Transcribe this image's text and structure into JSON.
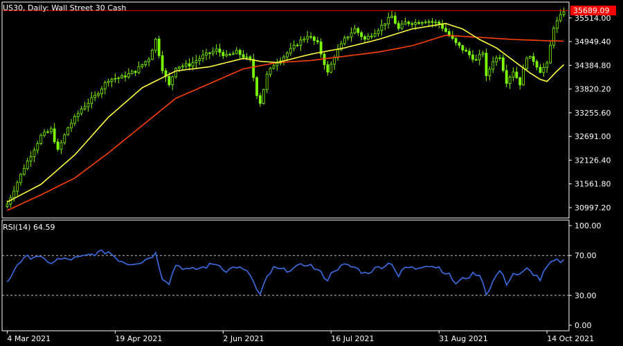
{
  "window": {
    "title_line": "US30, Daily:  Wall Street 30 Cash",
    "rsi_title": "RSI(14) 64.59"
  },
  "colors": {
    "background": "#000000",
    "frame": "#ffffff",
    "bull_candle": "#7cfc00",
    "bear_candle": "#7cfc00",
    "ma_fast": "#ffff40",
    "ma_slow": "#ff4000",
    "rsi_line": "#3c6ee6",
    "price_line": "#ff0000",
    "level_line": "#c0c0c0"
  },
  "chart_data": [
    {
      "type": "candlestick",
      "title": "US30, Daily:  Wall Street 30 Cash",
      "price_label": "35689.09",
      "price_line_value": 35689.09,
      "y_ticks": [
        "35514.00",
        "34949.40",
        "34384.80",
        "33820.20",
        "33255.60",
        "32691.00",
        "32126.40",
        "31561.80",
        "30997.20"
      ],
      "y_tick_values": [
        35514.0,
        34949.4,
        34384.8,
        33820.2,
        33255.6,
        32691.0,
        32126.4,
        31561.8,
        30997.2
      ],
      "ylim": [
        30750,
        35890
      ],
      "x_ticks": [
        "4 Mar 2021",
        "19 Apr 2021",
        "2 Jun 2021",
        "16 Jul 2021",
        "31 Aug 2021",
        "14 Oct 2021"
      ],
      "x_tick_index": [
        0,
        32,
        64,
        96,
        128,
        160
      ],
      "bar_count": 166,
      "series": [
        {
          "name": "MA fast",
          "color": "#ffff40"
        },
        {
          "name": "MA slow",
          "color": "#ff4000"
        }
      ],
      "anchors_close": [
        [
          0,
          31080
        ],
        [
          5,
          31950
        ],
        [
          10,
          32700
        ],
        [
          13,
          32850
        ],
        [
          15,
          32350
        ],
        [
          18,
          32900
        ],
        [
          22,
          33350
        ],
        [
          26,
          33650
        ],
        [
          30,
          34050
        ],
        [
          34,
          34100
        ],
        [
          38,
          34250
        ],
        [
          42,
          34550
        ],
        [
          44,
          35000
        ],
        [
          46,
          34300
        ],
        [
          48,
          33900
        ],
        [
          50,
          34350
        ],
        [
          54,
          34400
        ],
        [
          58,
          34600
        ],
        [
          62,
          34750
        ],
        [
          65,
          34600
        ],
        [
          68,
          34700
        ],
        [
          72,
          34500
        ],
        [
          74,
          33700
        ],
        [
          75,
          33500
        ],
        [
          77,
          34150
        ],
        [
          79,
          34400
        ],
        [
          82,
          34600
        ],
        [
          86,
          34900
        ],
        [
          89,
          35100
        ],
        [
          92,
          34900
        ],
        [
          95,
          34200
        ],
        [
          97,
          34600
        ],
        [
          100,
          35000
        ],
        [
          103,
          35250
        ],
        [
          106,
          35000
        ],
        [
          110,
          35250
        ],
        [
          114,
          35550
        ],
        [
          116,
          35250
        ],
        [
          118,
          35400
        ],
        [
          121,
          35400
        ],
        [
          124,
          35450
        ],
        [
          128,
          35380
        ],
        [
          131,
          35100
        ],
        [
          133,
          34900
        ],
        [
          136,
          34700
        ],
        [
          139,
          34500
        ],
        [
          141,
          34700
        ],
        [
          142,
          34100
        ],
        [
          144,
          34500
        ],
        [
          146,
          34600
        ],
        [
          148,
          34000
        ],
        [
          150,
          34250
        ],
        [
          152,
          33950
        ],
        [
          154,
          34600
        ],
        [
          156,
          34500
        ],
        [
          158,
          34250
        ],
        [
          160,
          34400
        ],
        [
          162,
          35300
        ],
        [
          164,
          35550
        ],
        [
          165,
          35689
        ]
      ],
      "anchors_ma_fast": [
        [
          0,
          31130
        ],
        [
          10,
          31550
        ],
        [
          20,
          32250
        ],
        [
          30,
          33150
        ],
        [
          40,
          33850
        ],
        [
          50,
          34250
        ],
        [
          60,
          34350
        ],
        [
          70,
          34550
        ],
        [
          75,
          34480
        ],
        [
          80,
          34450
        ],
        [
          90,
          34650
        ],
        [
          100,
          34800
        ],
        [
          110,
          35000
        ],
        [
          120,
          35250
        ],
        [
          130,
          35380
        ],
        [
          135,
          35250
        ],
        [
          140,
          35000
        ],
        [
          145,
          34800
        ],
        [
          150,
          34500
        ],
        [
          155,
          34200
        ],
        [
          158,
          34050
        ],
        [
          160,
          34000
        ],
        [
          163,
          34250
        ],
        [
          165,
          34400
        ]
      ],
      "anchors_ma_slow": [
        [
          0,
          30930
        ],
        [
          10,
          31300
        ],
        [
          20,
          31700
        ],
        [
          30,
          32300
        ],
        [
          40,
          32950
        ],
        [
          50,
          33600
        ],
        [
          60,
          33950
        ],
        [
          70,
          34300
        ],
        [
          80,
          34450
        ],
        [
          90,
          34500
        ],
        [
          100,
          34600
        ],
        [
          110,
          34700
        ],
        [
          120,
          34850
        ],
        [
          130,
          35100
        ],
        [
          140,
          35050
        ],
        [
          150,
          35000
        ],
        [
          160,
          34970
        ],
        [
          165,
          34960
        ]
      ]
    },
    {
      "type": "line",
      "title": "RSI(14) 64.59",
      "y_ticks": [
        "100.00",
        "70.00",
        "30.00",
        "0.00"
      ],
      "y_tick_values": [
        100,
        70,
        30,
        0
      ],
      "levels": [
        70,
        30
      ],
      "ylim": [
        0,
        100
      ],
      "anchors": [
        [
          0,
          42
        ],
        [
          3,
          62
        ],
        [
          6,
          68
        ],
        [
          9,
          70
        ],
        [
          12,
          62
        ],
        [
          15,
          66
        ],
        [
          18,
          66
        ],
        [
          22,
          68
        ],
        [
          26,
          72
        ],
        [
          30,
          74
        ],
        [
          33,
          66
        ],
        [
          36,
          62
        ],
        [
          40,
          64
        ],
        [
          44,
          72
        ],
        [
          46,
          48
        ],
        [
          48,
          43
        ],
        [
          50,
          61
        ],
        [
          54,
          55
        ],
        [
          58,
          58
        ],
        [
          62,
          62
        ],
        [
          65,
          55
        ],
        [
          68,
          59
        ],
        [
          72,
          51
        ],
        [
          74,
          35
        ],
        [
          75,
          30
        ],
        [
          77,
          48
        ],
        [
          79,
          57
        ],
        [
          82,
          55
        ],
        [
          86,
          58
        ],
        [
          89,
          62
        ],
        [
          92,
          55
        ],
        [
          95,
          46
        ],
        [
          97,
          56
        ],
        [
          100,
          60
        ],
        [
          103,
          58
        ],
        [
          106,
          52
        ],
        [
          110,
          58
        ],
        [
          114,
          63
        ],
        [
          116,
          49
        ],
        [
          118,
          58
        ],
        [
          121,
          57
        ],
        [
          124,
          61
        ],
        [
          128,
          58
        ],
        [
          131,
          50
        ],
        [
          133,
          42
        ],
        [
          136,
          48
        ],
        [
          139,
          52
        ],
        [
          141,
          45
        ],
        [
          142,
          31
        ],
        [
          144,
          44
        ],
        [
          146,
          55
        ],
        [
          148,
          42
        ],
        [
          150,
          52
        ],
        [
          152,
          50
        ],
        [
          154,
          56
        ],
        [
          156,
          52
        ],
        [
          158,
          46
        ],
        [
          160,
          58
        ],
        [
          162,
          64
        ],
        [
          164,
          64.5
        ],
        [
          165,
          64.59
        ]
      ]
    }
  ]
}
